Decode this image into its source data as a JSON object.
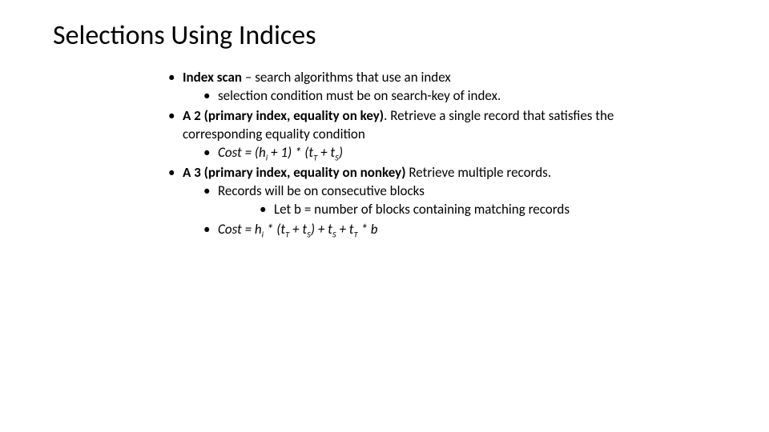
{
  "title": "Selections Using Indices",
  "b1_bold": "Index scan ",
  "b1_rest": "– search algorithms that use an index",
  "b1_sub": "selection condition must be on search-key of index.",
  "b2_bold": "A 2 (primary index, equality on key)",
  "b2_rest": ".  Retrieve a single record that satisfies the corresponding equality condition",
  "b2_cost_label": "Cost = (h",
  "b2_cost_i": "i",
  "b2_cost_mid1": " + 1) * (t",
  "b2_cost_T": "T",
  "b2_cost_mid2": " + t",
  "b2_cost_S": "S",
  "b2_cost_end": ")",
  "b3_bold": "A 3 (primary index, equality on nonkey)",
  "b3_rest": " Retrieve multiple records.",
  "b3_sub1": "Records will be on consecutive blocks",
  "b3_sub1a": "Let b = number of blocks containing matching records",
  "b3_cost_label": "Cost = h",
  "b3_cost_i": "i",
  "b3_cost_mid1": " * (t",
  "b3_cost_T1": "T",
  "b3_cost_mid2": " + t",
  "b3_cost_S1": "S",
  "b3_cost_mid3": ") + t",
  "b3_cost_S2": "S",
  "b3_cost_mid4": " + t",
  "b3_cost_T2": "T",
  "b3_cost_end": " * b"
}
